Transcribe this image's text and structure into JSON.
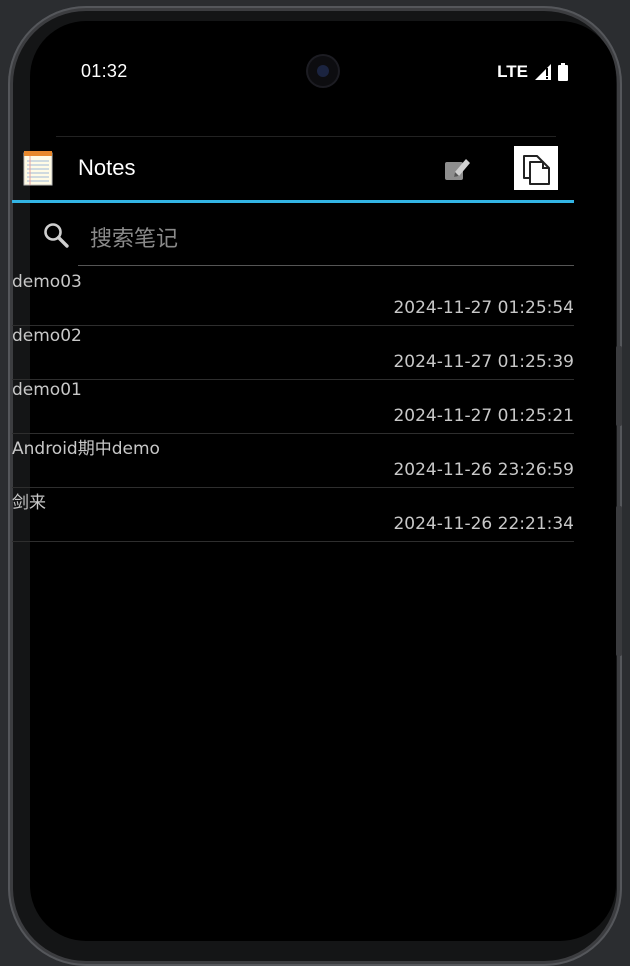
{
  "status_bar": {
    "time": "01:32",
    "network": "LTE"
  },
  "app": {
    "title": "Notes",
    "icons": {
      "logo": "notepad-icon",
      "new_note": "edit-note-icon",
      "paste": "paste-icon"
    }
  },
  "search": {
    "placeholder": "搜索笔记",
    "value": ""
  },
  "notes": [
    {
      "title": "demo03",
      "time": "2024-11-27 01:25:54"
    },
    {
      "title": "demo02",
      "time": "2024-11-27 01:25:39"
    },
    {
      "title": "demo01",
      "time": "2024-11-27 01:25:21"
    },
    {
      "title": "Android期中demo",
      "time": "2024-11-26 23:26:59"
    },
    {
      "title": "剑来",
      "time": "2024-11-26 22:21:34"
    }
  ],
  "colors": {
    "accent": "#33b5e5",
    "background": "#000000",
    "text": "#c8c8c8"
  }
}
